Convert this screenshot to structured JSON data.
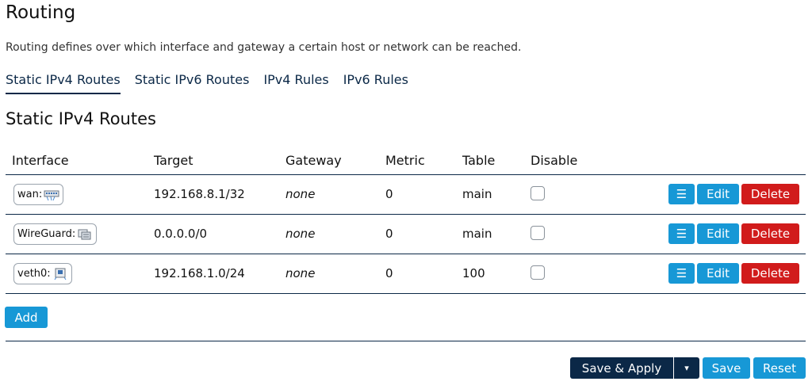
{
  "page": {
    "title": "Routing",
    "description": "Routing defines over which interface and gateway a certain host or network can be reached."
  },
  "tabs": [
    {
      "label": "Static IPv4 Routes",
      "active": true
    },
    {
      "label": "Static IPv6 Routes",
      "active": false
    },
    {
      "label": "IPv4 Rules",
      "active": false
    },
    {
      "label": "IPv6 Rules",
      "active": false
    }
  ],
  "section": {
    "title": "Static IPv4 Routes"
  },
  "table": {
    "headers": {
      "interface": "Interface",
      "target": "Target",
      "gateway": "Gateway",
      "metric": "Metric",
      "table": "Table",
      "disable": "Disable"
    },
    "rows": [
      {
        "interface": "wan:",
        "icon": "ethernet-switch-icon",
        "target": "192.168.8.1/32",
        "gateway": "none",
        "metric": "0",
        "table": "main",
        "disabled": false
      },
      {
        "interface": "WireGuard:",
        "icon": "tunnel-icon",
        "target": "0.0.0.0/0",
        "gateway": "none",
        "metric": "0",
        "table": "main",
        "disabled": false
      },
      {
        "interface": "veth0:",
        "icon": "ethernet-port-icon",
        "target": "192.168.1.0/24",
        "gateway": "none",
        "metric": "0",
        "table": "100",
        "disabled": false
      }
    ],
    "row_actions": {
      "menu": "☰",
      "edit": "Edit",
      "delete": "Delete"
    }
  },
  "add_label": "Add",
  "footer": {
    "save_apply": "Save & Apply",
    "dropdown": "▾",
    "save": "Save",
    "reset": "Reset"
  },
  "colors": {
    "accent": "#1798d6",
    "danger": "#d11b1b",
    "dark": "#0b2847"
  }
}
